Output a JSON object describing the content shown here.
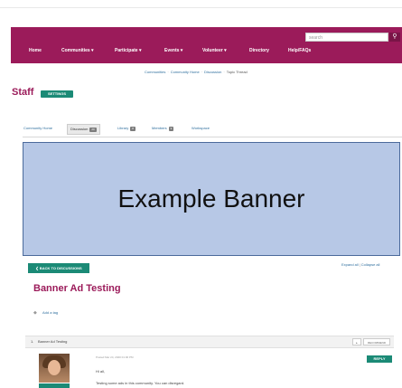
{
  "search": {
    "placeholder": "search",
    "button_icon": "magnifier-icon"
  },
  "nav": {
    "background": "#9b1b5a",
    "items": [
      "Home",
      "Communities ▾",
      "Participate ▾",
      "Events ▾",
      "Volunteer ▾",
      "Directory",
      "Help/FAQs"
    ]
  },
  "breadcrumb": [
    "Communities",
    "Community Home",
    "Discussion",
    "Topic Thread"
  ],
  "page": {
    "title": "Staff",
    "settings_label": "SETTINGS"
  },
  "tabs": [
    {
      "label": "Community Home",
      "badge": ""
    },
    {
      "label": "Discussion",
      "badge": "20"
    },
    {
      "label": "Library",
      "badge": "8"
    },
    {
      "label": "Members",
      "badge": "9"
    },
    {
      "label": "Workspace",
      "badge": ""
    }
  ],
  "banner": {
    "text": "Example Banner",
    "background": "#b7c8e6"
  },
  "thread": {
    "back_label": "❮ BACK TO DISCUSSIONS",
    "expand_all": "Expand all",
    "collapse_all": "Collapse all",
    "title": "Banner Ad Testing",
    "add_tag": "Add a tag",
    "bar_number": "1.",
    "bar_title": "Banner Ad Testing",
    "bar_btn_1": "▸",
    "bar_btn_2": "RECOMMEND"
  },
  "post": {
    "date": "Posted Mar 24, 2020 01:00 PM",
    "reply_label": "REPLY",
    "line1": "Hi all,",
    "line2": "Testing some ads in this community. You can disregard."
  },
  "accent": "#1b8a76"
}
